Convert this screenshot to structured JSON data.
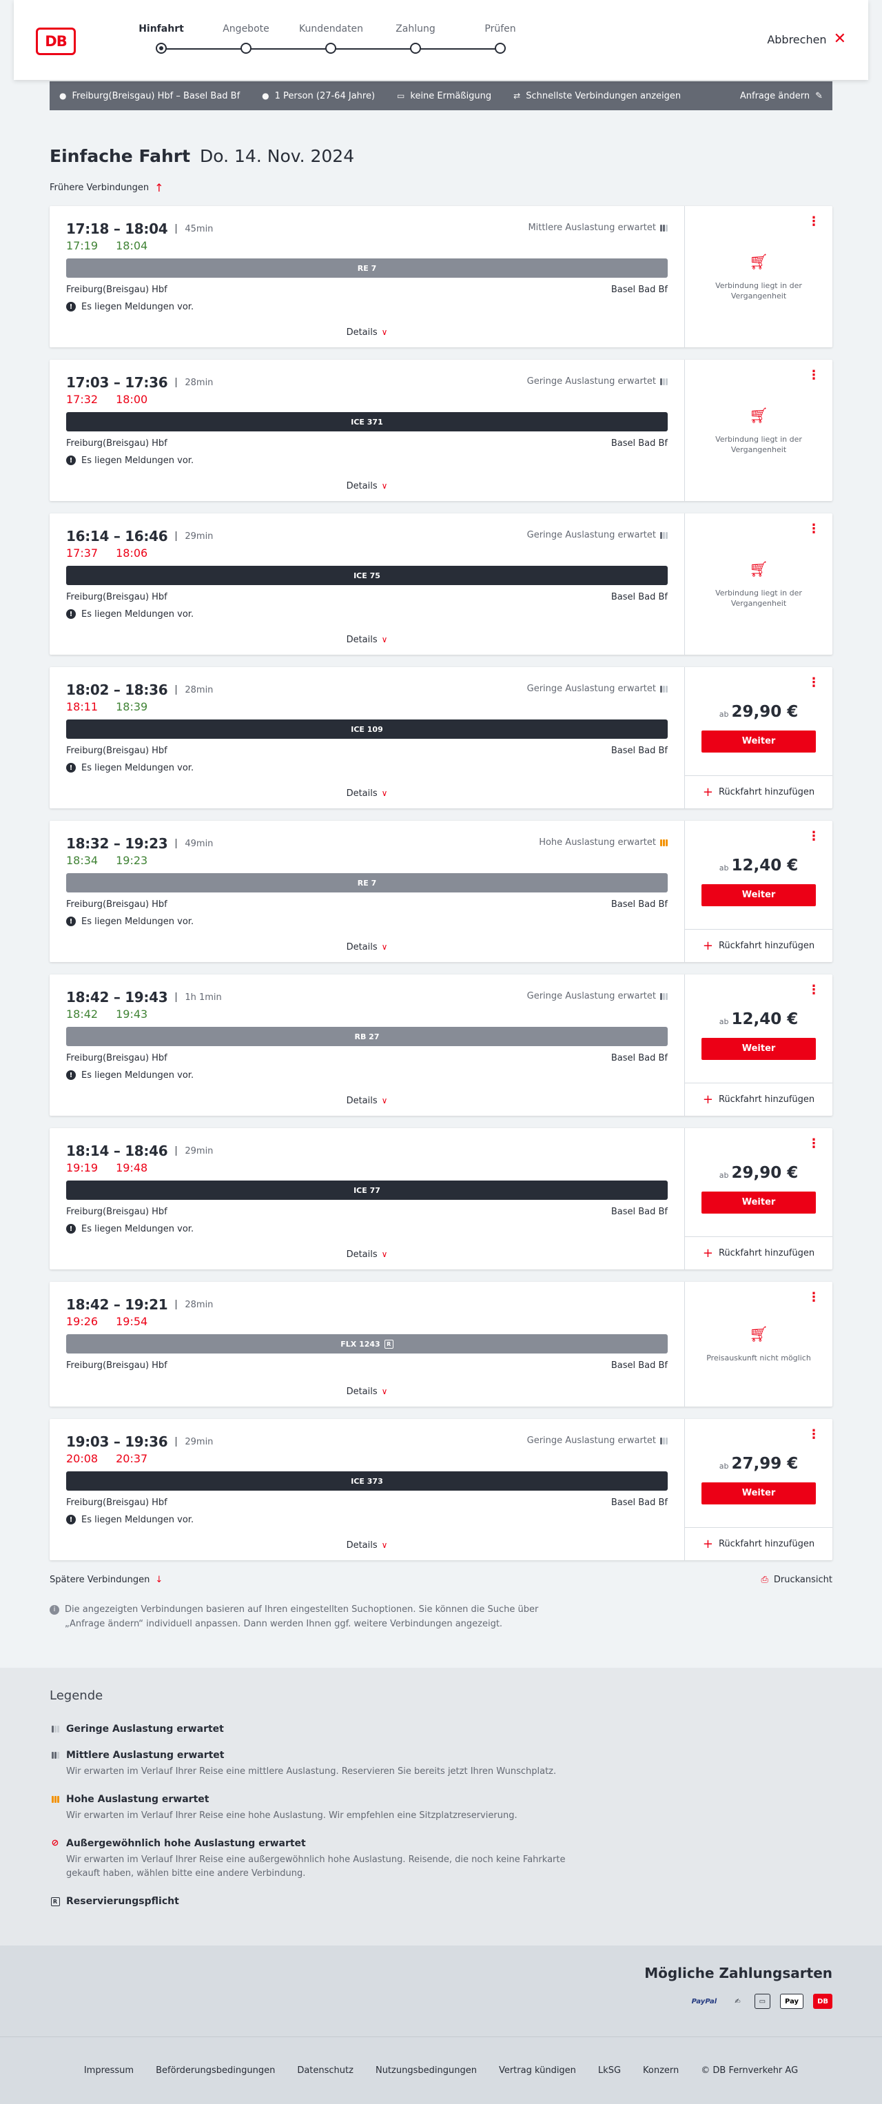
{
  "header": {
    "logo": "DB",
    "steps": [
      "Hinfahrt",
      "Angebote",
      "Kundendaten",
      "Zahlung",
      "Prüfen"
    ],
    "cancel_label": "Abbrechen"
  },
  "summary": {
    "route": "Freiburg(Breisgau) Hbf – Basel Bad Bf",
    "passengers": "1 Person (27-64 Jahre)",
    "discount": "keine Ermäßigung",
    "fastest": "Schnellste Verbindungen anzeigen",
    "change": "Anfrage ändern"
  },
  "page": {
    "title": "Einfache Fahrt",
    "date": "Do. 14. Nov. 2024",
    "earlier": "Frühere Verbindungen",
    "later": "Spätere Verbindungen",
    "print": "Druckansicht",
    "info": "Die angezeigten Verbindungen basieren auf Ihren eingestellten Suchoptionen. Sie können die Suche über „Anfrage ändern“ individuell anpassen. Dann werden Ihnen ggf. weitere Verbindungen angezeigt."
  },
  "labels": {
    "details": "Details",
    "weiter": "Weiter",
    "return": "Rückfahrt hinzufügen",
    "ab": "ab"
  },
  "connections": [
    {
      "times": "17:18 – 18:04",
      "duration": "45min",
      "rt_dep": "17:19",
      "rt_arr": "18:04",
      "dep_color": "green",
      "arr_color": "green",
      "load": "Mittlere Auslastung erwartet",
      "load_level": 2,
      "train": "RE 7",
      "train_style": "grey",
      "from": "Freiburg(Breisgau) Hbf",
      "to": "Basel Bad Bf",
      "message": "Es liegen Meldungen vor.",
      "side": "past",
      "side_text": "Verbindung liegt in der Vergangenheit"
    },
    {
      "times": "17:03 – 17:36",
      "duration": "28min",
      "rt_dep": "17:32",
      "rt_arr": "18:00",
      "dep_color": "red",
      "arr_color": "red",
      "load": "Geringe Auslastung erwartet",
      "load_level": 1,
      "train": "ICE 371",
      "train_style": "dark",
      "from": "Freiburg(Breisgau) Hbf",
      "to": "Basel Bad Bf",
      "message": "Es liegen Meldungen vor.",
      "side": "past",
      "side_text": "Verbindung liegt in der Vergangenheit"
    },
    {
      "times": "16:14 – 16:46",
      "duration": "29min",
      "rt_dep": "17:37",
      "rt_arr": "18:06",
      "dep_color": "red",
      "arr_color": "red",
      "load": "Geringe Auslastung erwartet",
      "load_level": 1,
      "train": "ICE 75",
      "train_style": "dark",
      "from": "Freiburg(Breisgau) Hbf",
      "to": "Basel Bad Bf",
      "message": "Es liegen Meldungen vor.",
      "side": "past",
      "side_text": "Verbindung liegt in der Vergangenheit"
    },
    {
      "times": "18:02 – 18:36",
      "duration": "28min",
      "rt_dep": "18:11",
      "rt_arr": "18:39",
      "dep_color": "red",
      "arr_color": "green",
      "load": "Geringe Auslastung erwartet",
      "load_level": 1,
      "train": "ICE 109",
      "train_style": "dark",
      "from": "Freiburg(Breisgau) Hbf",
      "to": "Basel Bad Bf",
      "message": "Es liegen Meldungen vor.",
      "side": "price",
      "price": "29,90 €"
    },
    {
      "times": "18:32 – 19:23",
      "duration": "49min",
      "rt_dep": "18:34",
      "rt_arr": "19:23",
      "dep_color": "green",
      "arr_color": "green",
      "load": "Hohe Auslastung erwartet",
      "load_level": 3,
      "train": "RE 7",
      "train_style": "grey",
      "from": "Freiburg(Breisgau) Hbf",
      "to": "Basel Bad Bf",
      "message": "Es liegen Meldungen vor.",
      "side": "price",
      "price": "12,40 €"
    },
    {
      "times": "18:42 – 19:43",
      "duration": "1h 1min",
      "rt_dep": "18:42",
      "rt_arr": "19:43",
      "dep_color": "green",
      "arr_color": "green",
      "load": "Geringe Auslastung erwartet",
      "load_level": 1,
      "train": "RB 27",
      "train_style": "grey",
      "from": "Freiburg(Breisgau) Hbf",
      "to": "Basel Bad Bf",
      "message": "Es liegen Meldungen vor.",
      "side": "price",
      "price": "12,40 €"
    },
    {
      "times": "18:14 – 18:46",
      "duration": "29min",
      "rt_dep": "19:19",
      "rt_arr": "19:48",
      "dep_color": "red",
      "arr_color": "red",
      "load": "",
      "load_level": 0,
      "train": "ICE 77",
      "train_style": "dark",
      "from": "Freiburg(Breisgau) Hbf",
      "to": "Basel Bad Bf",
      "message": "Es liegen Meldungen vor.",
      "side": "price",
      "price": "29,90 €"
    },
    {
      "times": "18:42 – 19:21",
      "duration": "28min",
      "rt_dep": "19:26",
      "rt_arr": "19:54",
      "dep_color": "red",
      "arr_color": "red",
      "load": "",
      "load_level": 0,
      "train": "FLX 1243",
      "train_style": "grey",
      "train_badge": "R",
      "from": "Freiburg(Breisgau) Hbf",
      "to": "Basel Bad Bf",
      "message": "",
      "side": "past",
      "side_text": "Preisauskunft nicht möglich"
    },
    {
      "times": "19:03 – 19:36",
      "duration": "29min",
      "rt_dep": "20:08",
      "rt_arr": "20:37",
      "dep_color": "red",
      "arr_color": "red",
      "load": "Geringe Auslastung erwartet",
      "load_level": 1,
      "train": "ICE 373",
      "train_style": "dark",
      "from": "Freiburg(Breisgau) Hbf",
      "to": "Basel Bad Bf",
      "message": "Es liegen Meldungen vor.",
      "side": "price",
      "price": "27,99 €"
    }
  ],
  "legend": {
    "title": "Legende",
    "items": [
      {
        "icon": "low-load-icon",
        "title": "Geringe Auslastung erwartet",
        "desc": ""
      },
      {
        "icon": "medium-load-icon",
        "title": "Mittlere Auslastung erwartet",
        "desc": "Wir erwarten im Verlauf Ihrer Reise eine mittlere Auslastung. Reservieren Sie bereits jetzt Ihren Wunschplatz."
      },
      {
        "icon": "high-load-icon",
        "title": "Hohe Auslastung erwartet",
        "desc": "Wir erwarten im Verlauf Ihrer Reise eine hohe Auslastung. Wir empfehlen eine Sitzplatzreservierung."
      },
      {
        "icon": "extreme-load-icon",
        "title": "Außergewöhnlich hohe Auslastung erwartet",
        "desc": "Wir erwarten im Verlauf Ihrer Reise eine außergewöhnlich hohe Auslastung. Reisende, die noch keine Fahrkarte gekauft haben, wählen bitte eine andere Verbindung."
      },
      {
        "icon": "reservation-required-icon",
        "title": "Reservierungspflicht",
        "desc": ""
      }
    ]
  },
  "payment": {
    "title": "Mögliche Zahlungsarten",
    "methods": [
      "PayPal",
      "Pay",
      "DB"
    ]
  },
  "footer": {
    "links": [
      "Impressum",
      "Beförderungsbedingungen",
      "Datenschutz",
      "Nutzungsbedingungen",
      "Vertrag kündigen",
      "LkSG",
      "Konzern",
      "© DB Fernverkehr AG"
    ]
  }
}
